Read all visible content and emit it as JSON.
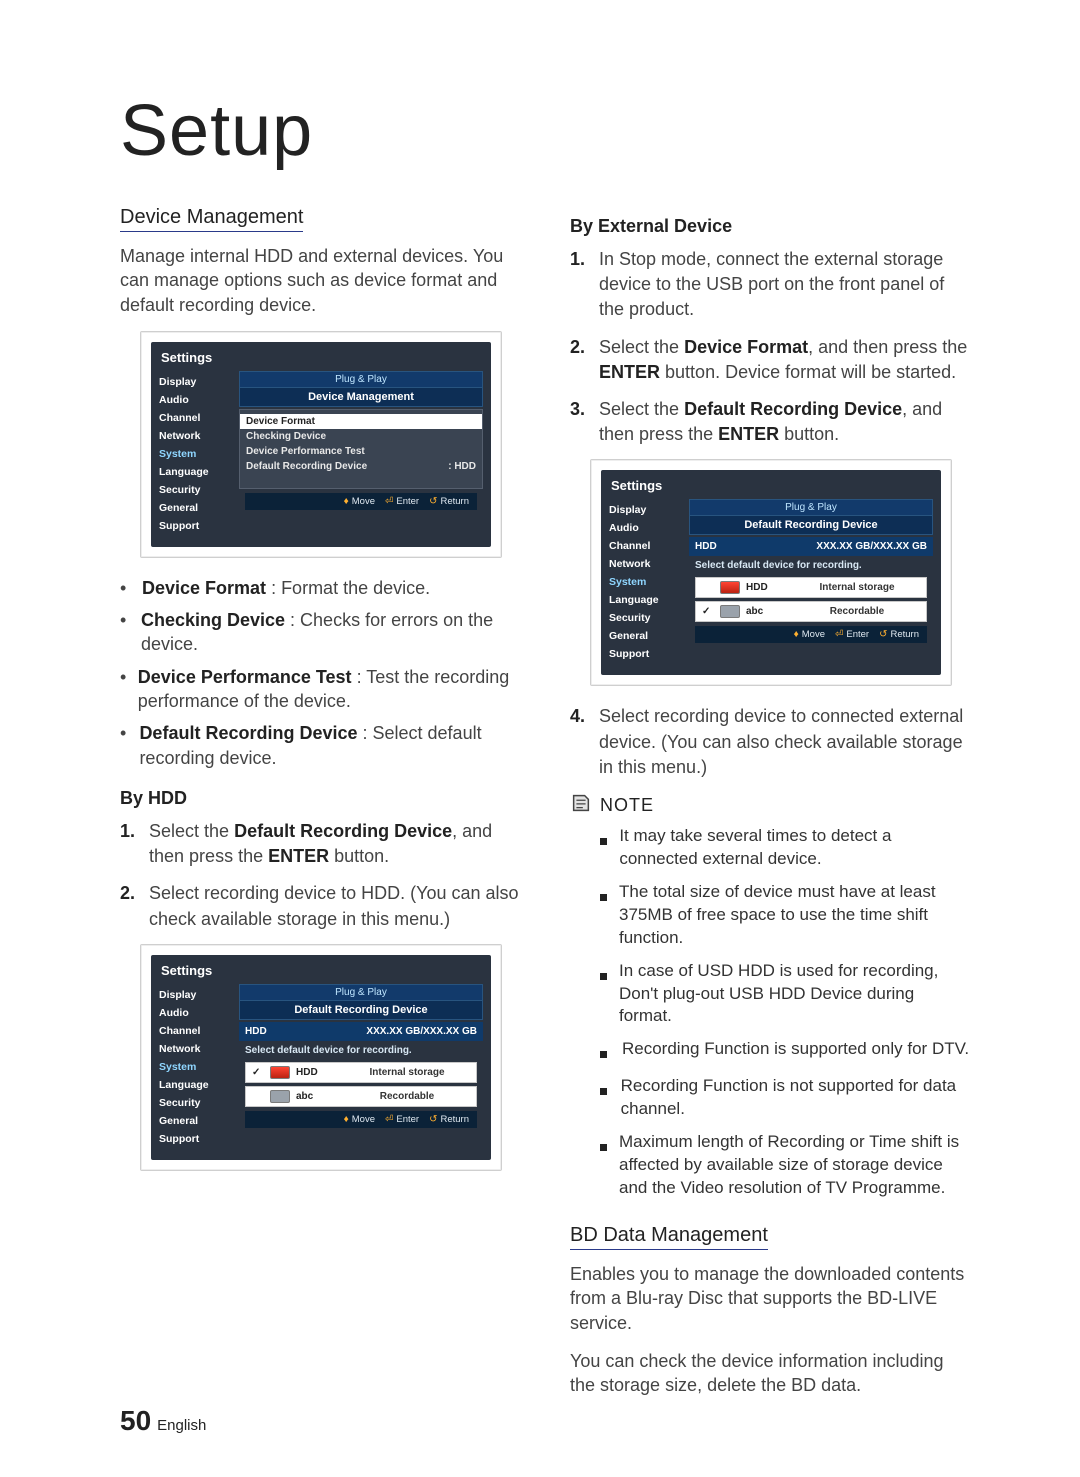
{
  "page": {
    "title": "Setup",
    "number": "50",
    "lang": "English"
  },
  "left": {
    "section_title": "Device Management",
    "intro": "Manage internal HDD and external devices. You can manage options such as device format and default recording device.",
    "bullets": [
      {
        "label": "Device Format",
        "desc": " : Format the device."
      },
      {
        "label": "Checking Device",
        "desc": " : Checks for errors on the device."
      },
      {
        "label": "Device Performance Test",
        "desc": " : Test the recording performance of the device."
      },
      {
        "label": "Default Recording Device",
        "desc": " : Select default recording device."
      }
    ],
    "by_hdd": {
      "title": "By HDD",
      "steps": [
        {
          "n": "1.",
          "strong": "Default Recording Device",
          "text_before": "Select the ",
          "text_mid": ", and then press the ",
          "strong2": "ENTER",
          "text_after": " button."
        },
        {
          "n": "2.",
          "text": "Select recording device to HDD. (You can also check available storage in this menu.)"
        }
      ]
    }
  },
  "right": {
    "by_ext": {
      "title": "By External Device",
      "steps": [
        {
          "n": "1.",
          "text": "In Stop mode, connect the external storage device to the USB port on the front panel of the product."
        },
        {
          "n": "2.",
          "text_before": "Select the ",
          "s1": "Device Format",
          "mid": ", and then press the ",
          "s2": "ENTER",
          "after": " button. Device format will be started."
        },
        {
          "n": "3.",
          "text_before": "Select the ",
          "s1": "Default Recording Device",
          "mid": ", and then press the ",
          "s2": "ENTER",
          "after": " button."
        }
      ],
      "step4": {
        "n": "4.",
        "text": "Select recording device to connected external device. (You can also check available storage in this menu.)"
      }
    },
    "note_label": "NOTE",
    "notes": [
      "It may take several times to detect a connected external device.",
      "The total size of device must have at least 375MB of free space to use the time shift function.",
      "In case of USD HDD is used for recording, Don't plug-out USB HDD Device during format.",
      "Recording Function is supported only for DTV.",
      "Recording Function is not supported for data channel.",
      "Maximum length of Recording or Time shift is affected by available size of storage device and the Video resolution of TV Programme."
    ],
    "bd": {
      "title": "BD Data Management",
      "p1": "Enables you to manage the downloaded contents from a Blu-ray Disc that supports the BD-LIVE service.",
      "p2": "You can check the device information including the storage size, delete the BD data."
    }
  },
  "ui": {
    "settings": "Settings",
    "sidebar": [
      "Display",
      "Audio",
      "Channel",
      "Network",
      "System",
      "Language",
      "Security",
      "General",
      "Support"
    ],
    "crumb": "Plug & Play",
    "panel1": {
      "subtitle": "Device Management",
      "rows": [
        {
          "label": "Device Format",
          "val": ""
        },
        {
          "label": "Checking Device",
          "val": ""
        },
        {
          "label": "Device Performance Test",
          "val": ""
        },
        {
          "label": "Default Recording Device",
          "val": ": HDD"
        }
      ]
    },
    "panel_storage": {
      "subtitle": "Default Recording Device",
      "hdd": "HDD",
      "capacity": "XXX.XX GB/XXX.XX GB",
      "msg": "Select default device for recording.",
      "row1": {
        "name": "HDD",
        "desc": "Internal storage"
      },
      "row2": {
        "name": "abc",
        "desc": "Recordable"
      }
    },
    "help": {
      "move": "Move",
      "enter": "Enter",
      "ret": "Return"
    }
  }
}
